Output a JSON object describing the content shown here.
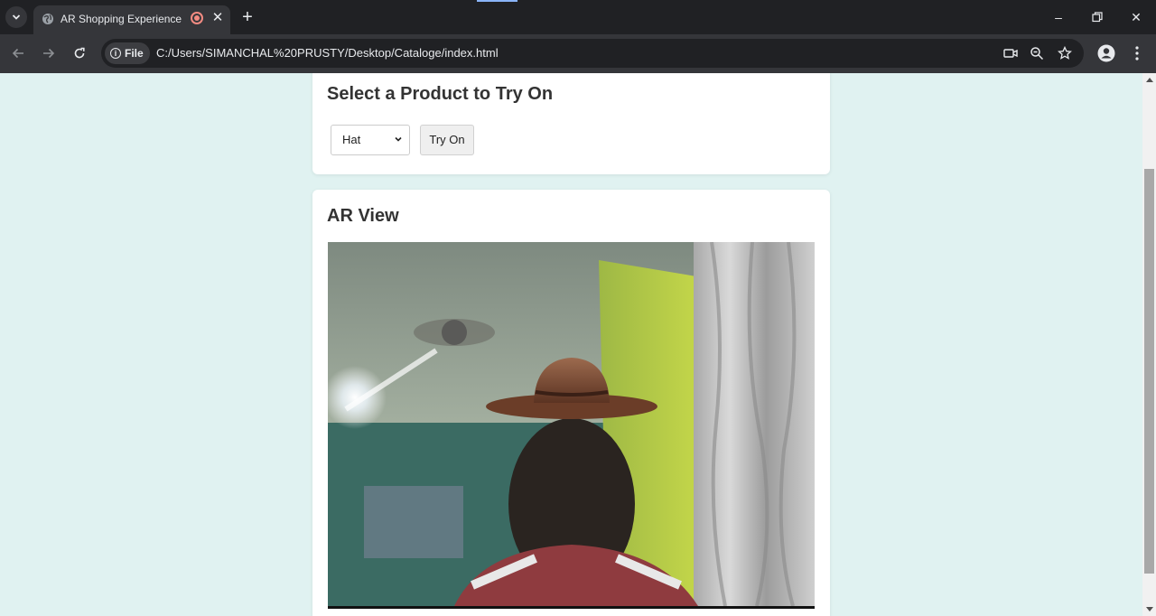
{
  "browser": {
    "tab_title": "AR Shopping Experience",
    "security_chip": "File",
    "url": "C:/Users/SIMANCHAL%20PRUSTY/Desktop/Cataloge/index.html"
  },
  "page": {
    "select_section_title": "Select a Product to Try On",
    "product_select_value": "Hat",
    "try_on_label": "Try On",
    "ar_section_title": "AR View"
  },
  "colors": {
    "page_background": "#e0f2f1",
    "card_background": "#ffffff",
    "chrome_dark": "#202124",
    "chrome_toolbar": "#35363a"
  },
  "icons": [
    "chevron-down-icon",
    "globe-icon",
    "recording-icon",
    "close-icon",
    "plus-icon",
    "minimize-icon",
    "restore-icon",
    "back-arrow-icon",
    "forward-arrow-icon",
    "reload-icon",
    "info-icon",
    "camera-icon",
    "zoom-icon",
    "star-icon",
    "profile-icon",
    "more-icon"
  ]
}
